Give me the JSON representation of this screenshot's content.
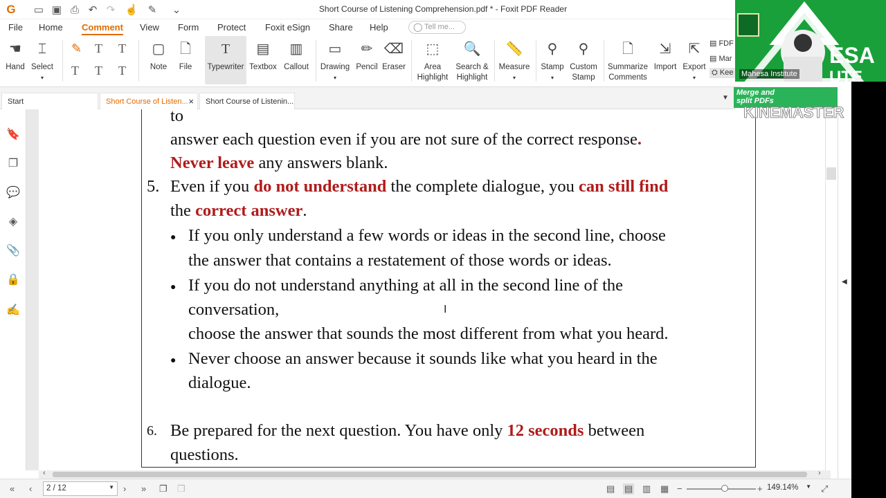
{
  "window": {
    "title": "Short Course of Listening Comprehension.pdf * - Foxit PDF Reader"
  },
  "menu": [
    {
      "label": "File"
    },
    {
      "label": "Home"
    },
    {
      "label": "Comment",
      "active": true
    },
    {
      "label": "View"
    },
    {
      "label": "Form"
    },
    {
      "label": "Protect"
    },
    {
      "label": "Foxit eSign"
    },
    {
      "label": "Share"
    },
    {
      "label": "Help"
    }
  ],
  "tellme": {
    "placeholder": "Tell me..."
  },
  "ribbon": {
    "hand": "Hand",
    "select": "Select",
    "note": "Note",
    "file": "File",
    "typewriter": "Typewriter",
    "textbox": "Textbox",
    "callout": "Callout",
    "drawing": "Drawing",
    "pencil": "Pencil",
    "eraser": "Eraser",
    "area_highlight_1": "Area",
    "area_highlight_2": "Highlight",
    "search_highlight_1": "Search &",
    "search_highlight_2": "Highlight",
    "measure": "Measure",
    "stamp": "Stamp",
    "custom_stamp_1": "Custom",
    "custom_stamp_2": "Stamp",
    "summarize_1": "Summarize",
    "summarize_2": "Comments",
    "import": "Import",
    "export": "Export",
    "side_fdf": "FDF",
    "side_ma": "Mar",
    "side_kee": "Kee"
  },
  "tabs": {
    "start": "Start",
    "tab1": "Short Course of Listen...",
    "tab2": "Short Course of Listenin..."
  },
  "document": {
    "l1": "to",
    "l2a": "answer each question even if you are not sure of the correct response",
    "l2b": ".",
    "l3a": "Never leave",
    "l3b": " any answers blank.",
    "n5": "5.",
    "l4a": "Even if you ",
    "l4b": "do not understand",
    "l4c": " the complete dialogue, you ",
    "l4d": "can still find",
    "l5a": "the ",
    "l5b": "correct answer",
    "l5c": ".",
    "b1a": "If you only understand a few words or ideas in the second line, choose",
    "b1b": "the answer that contains a restatement of those words or ideas.",
    "b2a": "If you do not understand anything at all in the second line of the",
    "b2b": "conversation,",
    "b2c": "choose the answer that sounds the most different from what you heard.",
    "b3a": "Never choose an answer because it sounds like what you heard in the",
    "b3b": "dialogue.",
    "n6": "6.",
    "l6a": "Be prepared for the next question. You have only ",
    "l6b": "12 seconds",
    "l6c": " between",
    "l7": "questions."
  },
  "status": {
    "page": "2 / 12",
    "zoom": "149.14%"
  },
  "overlay": {
    "webcam_name": "Mahesa Institute",
    "webcam_text_1": "ESA",
    "webcam_text_2": "UTE",
    "merge_1": "Merge and",
    "merge_2": "split PDFs",
    "watermark": "KINEMASTER"
  },
  "colors": {
    "accent": "#e06c00",
    "emphasis": "#b01b1b",
    "webcam_bg": "#19a03a"
  }
}
